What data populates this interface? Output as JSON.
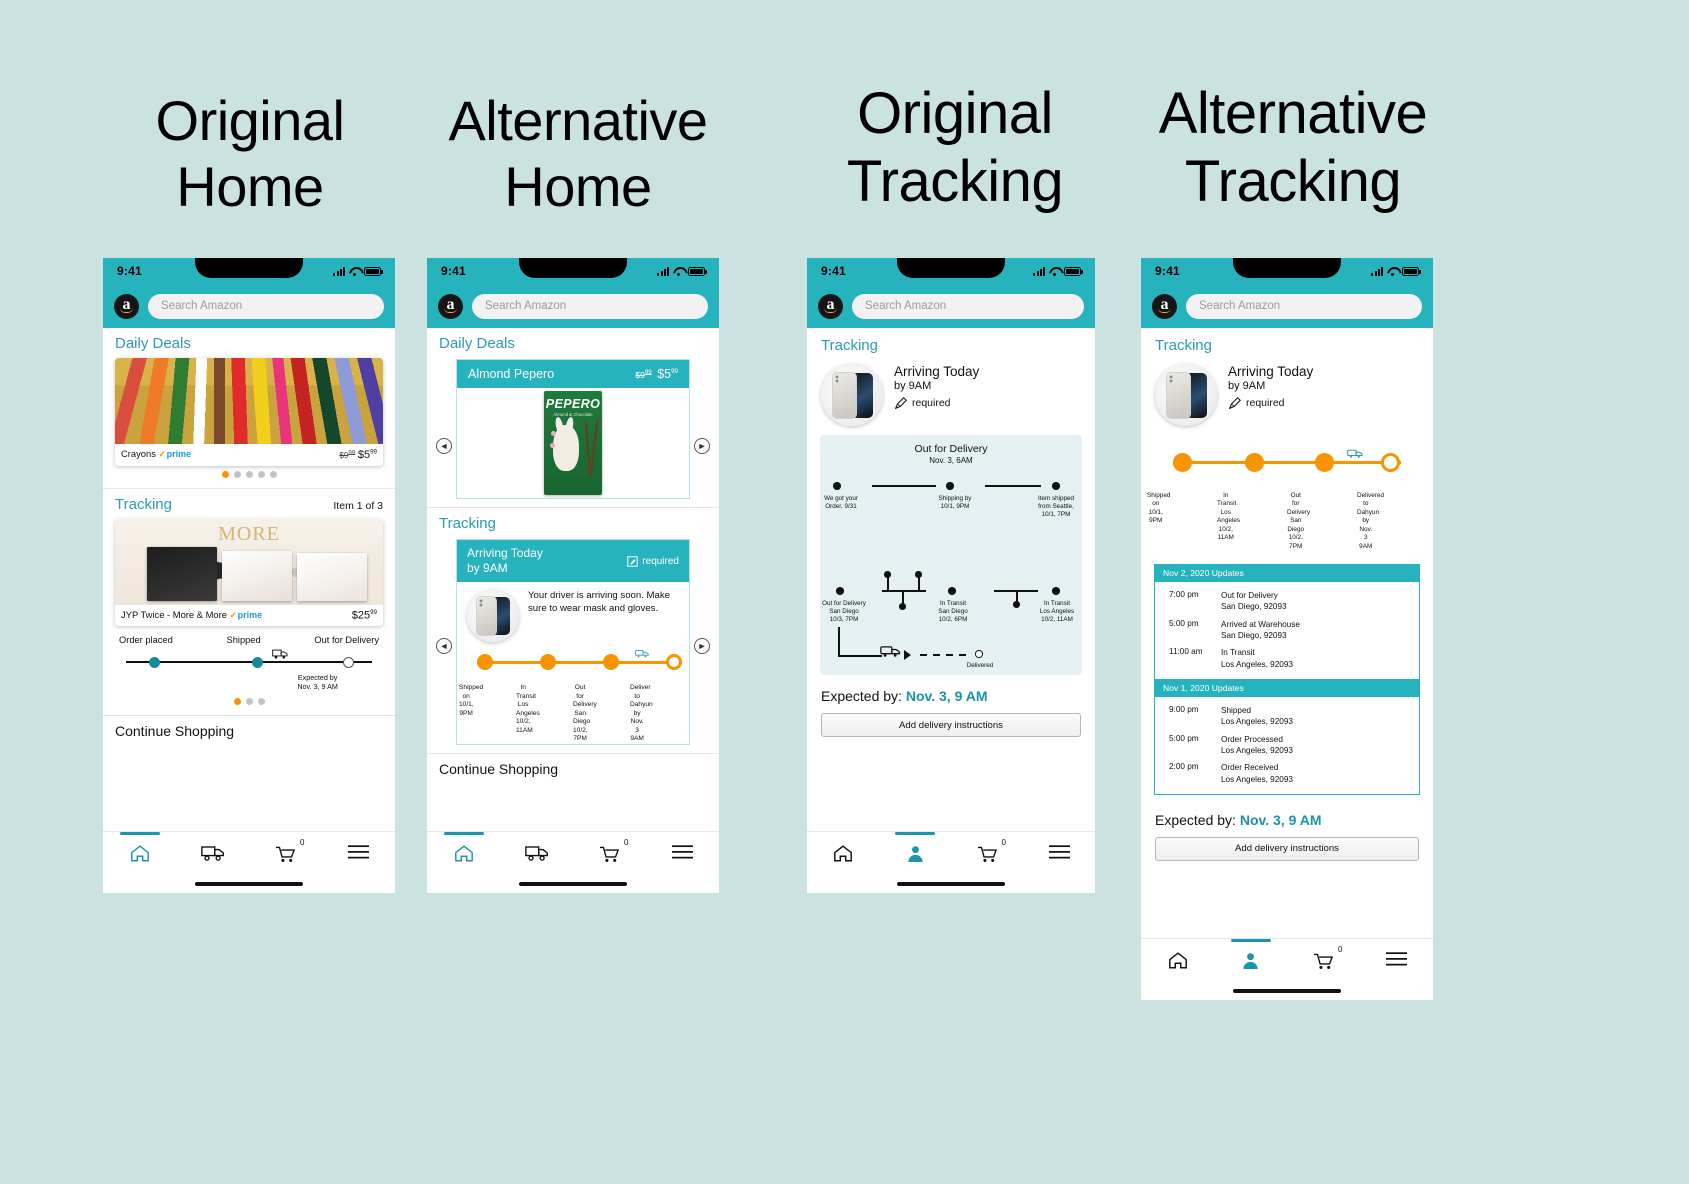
{
  "columns": [
    {
      "id": "c1",
      "line1": "Original",
      "line2": "Home"
    },
    {
      "id": "c2",
      "line1": "Alternative",
      "line2": "Home"
    },
    {
      "id": "c3",
      "line1": "Original",
      "line2": "Tracking"
    },
    {
      "id": "c4",
      "line1": "Alternative",
      "line2": "Tracking"
    }
  ],
  "status_bar": {
    "time": "9:41",
    "signal_icon": "signal-bars-icon",
    "wifi_icon": "wifi-icon",
    "battery_icon": "battery-icon"
  },
  "search": {
    "placeholder": "Search Amazon",
    "logo_letter": "a",
    "logo_name": "amazon-logo"
  },
  "nav": {
    "home": "home-icon",
    "orders": "truck-icon",
    "cart": "cart-icon",
    "menu": "hamburger-menu-icon",
    "account": "account-person-icon",
    "cart_count": "0"
  },
  "phone1": {
    "deals": {
      "title": "Daily Deals",
      "product": {
        "name": "Crayons",
        "prime": "prime",
        "price_old": "$9",
        "price_old_sup": "99",
        "price_new": "$5",
        "price_new_sup": "99"
      },
      "dots": 5,
      "active_dot": 0
    },
    "tracking": {
      "title": "Tracking",
      "meta": "Item 1 of 3",
      "product": {
        "name": "JYP Twice - More & More",
        "prime": "prime",
        "price": "$25",
        "price_sup": "99"
      },
      "steps": [
        "Order placed",
        "Shipped",
        "Out for Delivery"
      ],
      "expected_line1": "Expected by",
      "expected_line2": "Nov. 3, 9 AM",
      "dots": 3,
      "active_dot": 0
    },
    "continue_shopping": "Continue Shopping"
  },
  "phone2": {
    "deals": {
      "title": "Daily Deals",
      "product_name": "Almond Pepero",
      "price_old": "$9",
      "price_old_sup": "99",
      "price_new": "$5",
      "price_new_sup": "99",
      "pack_title": "PEPERO",
      "pack_sub": "Almond & Chocolate",
      "prev_arrow": "chevron-left-icon",
      "next_arrow": "chevron-right-icon"
    },
    "tracking": {
      "title": "Tracking",
      "headline": "Arriving Today",
      "subhead": "by 9AM",
      "required_label": "required",
      "required_icon": "pencil-edit-icon",
      "driver_message": "Your driver is arriving soon. Make sure to wear mask and gloves.",
      "steps": [
        {
          "l1": "Shipped on",
          "l2": "10/1, 9PM"
        },
        {
          "l1": "In Transit",
          "l2": "Los Angeles",
          "l3": "10/2, 11AM"
        },
        {
          "l1": "Out for Delivery",
          "l2": "San Diego",
          "l3": "10/2, 7PM"
        },
        {
          "l1": "Deliver",
          "l2": "to Dahyun",
          "l3": "by Nov. 3 9AM"
        }
      ]
    },
    "continue_shopping": "Continue Shopping"
  },
  "phone3": {
    "title": "Tracking",
    "headline": "Arriving Today",
    "subhead": "by 9AM",
    "required_label": "required",
    "required_icon": "pencil-edit-icon",
    "diagram": {
      "title": "Out for Delivery",
      "subtitle": "Nov. 3, 6AM",
      "nodes": [
        {
          "id": "n1",
          "l1": "We got your",
          "l2": "Order, 9/31"
        },
        {
          "id": "n2",
          "l1": "Shipping by",
          "l2": "10/1, 9PM"
        },
        {
          "id": "n3",
          "l1": "Item shipped",
          "l2": "from Seattle,",
          "l3": "10/1, 7PM"
        },
        {
          "id": "n4",
          "l1": "Out for Delivery",
          "l2": "San Diego",
          "l3": "10/3, 7PM"
        },
        {
          "id": "n5",
          "l1": "In Transit",
          "l2": "San Diego",
          "l3": "10/2, 6PM"
        },
        {
          "id": "n6",
          "l1": "In Transit",
          "l2": "Los Angeles",
          "l3": "10/2, 11AM"
        },
        {
          "id": "n7",
          "l1": "Delivered"
        }
      ],
      "truck_icon": "delivery-truck-icon"
    },
    "expected_prefix": "Expected by: ",
    "expected_date": "Nov. 3, 9 AM",
    "add_instructions": "Add delivery instructions"
  },
  "phone4": {
    "title": "Tracking",
    "headline": "Arriving Today",
    "subhead": "by 9AM",
    "required_label": "required",
    "required_icon": "pencil-edit-icon",
    "steps": [
      {
        "l1": "Shipped on",
        "l2": "10/1, 9PM"
      },
      {
        "l1": "In Transit",
        "l2": "Los Angeles",
        "l3": "10/2, 11AM"
      },
      {
        "l1": "Out for Delivery",
        "l2": "San Diego",
        "l3": "10/2, 7PM"
      },
      {
        "l1": "Delivered",
        "l2": "to Dahyun",
        "l3": "by Nov. 3 9AM"
      }
    ],
    "updates": [
      {
        "header": "Nov 2, 2020 Updates",
        "rows": [
          {
            "time": "7:00 pm",
            "event": "Out for Delivery",
            "place": "San Diego, 92093"
          },
          {
            "time": "5:00 pm",
            "event": "Arrived at Warehouse",
            "place": "San Diego, 92093"
          },
          {
            "time": "11:00 am",
            "event": "In Transit",
            "place": "Los Angeles, 92093"
          }
        ]
      },
      {
        "header": "Nov 1, 2020 Updates",
        "rows": [
          {
            "time": "9:00 pm",
            "event": "Shipped",
            "place": "Los Angeles, 92093"
          },
          {
            "time": "5:00 pm",
            "event": "Order Processed",
            "place": "Los Angeles, 92093"
          },
          {
            "time": "2:00 pm",
            "event": "Order Received",
            "place": "Los Angeles, 92093"
          }
        ]
      }
    ],
    "expected_prefix": "Expected by: ",
    "expected_date": "Nov. 3, 9 AM",
    "add_instructions": "Add delivery instructions"
  },
  "colors": {
    "background": "#cbe3e0",
    "teal": "#27b3bd",
    "teal_text": "#2a9cb0",
    "orange": "#f79400",
    "node_done": "#168a9a",
    "diagram_bg": "#e4f0f1"
  }
}
